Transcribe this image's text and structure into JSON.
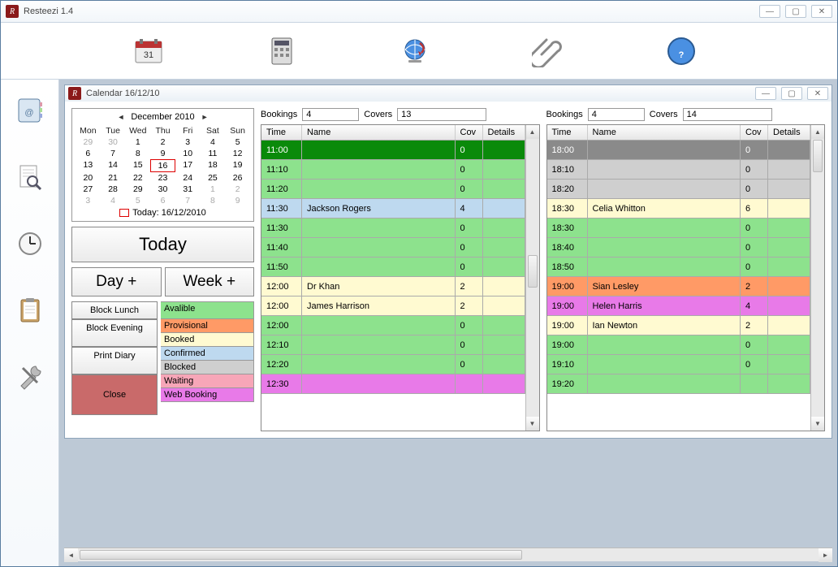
{
  "app": {
    "title": "Resteezi 1.4"
  },
  "calWin": {
    "title": "Calendar 16/12/10"
  },
  "month": {
    "label": "December 2010",
    "dow": [
      "Mon",
      "Tue",
      "Wed",
      "Thu",
      "Fri",
      "Sat",
      "Sun"
    ],
    "cells": [
      {
        "n": "29",
        "o": true
      },
      {
        "n": "30",
        "o": true
      },
      {
        "n": "1"
      },
      {
        "n": "2"
      },
      {
        "n": "3"
      },
      {
        "n": "4"
      },
      {
        "n": "5"
      },
      {
        "n": "6"
      },
      {
        "n": "7"
      },
      {
        "n": "8"
      },
      {
        "n": "9"
      },
      {
        "n": "10"
      },
      {
        "n": "11"
      },
      {
        "n": "12"
      },
      {
        "n": "13"
      },
      {
        "n": "14"
      },
      {
        "n": "15"
      },
      {
        "n": "16",
        "today": true
      },
      {
        "n": "17"
      },
      {
        "n": "18"
      },
      {
        "n": "19"
      },
      {
        "n": "20"
      },
      {
        "n": "21"
      },
      {
        "n": "22"
      },
      {
        "n": "23"
      },
      {
        "n": "24"
      },
      {
        "n": "25"
      },
      {
        "n": "26"
      },
      {
        "n": "27"
      },
      {
        "n": "28"
      },
      {
        "n": "29"
      },
      {
        "n": "30"
      },
      {
        "n": "31"
      },
      {
        "n": "1",
        "o": true
      },
      {
        "n": "2",
        "o": true
      },
      {
        "n": "3",
        "o": true
      },
      {
        "n": "4",
        "o": true
      },
      {
        "n": "5",
        "o": true
      },
      {
        "n": "6",
        "o": true
      },
      {
        "n": "7",
        "o": true
      },
      {
        "n": "8",
        "o": true
      },
      {
        "n": "9",
        "o": true
      }
    ],
    "todayLine": "Today: 16/12/2010"
  },
  "buttons": {
    "today": "Today",
    "dayPlus": "Day +",
    "weekPlus": "Week +",
    "blockLunch": "Block Lunch",
    "blockEvening": "Block Evening",
    "printDiary": "Print Diary",
    "close": "Close"
  },
  "legend": {
    "available": "Avalible",
    "provisional": "Provisional",
    "booked": "Booked",
    "confirmed": "Confirmed",
    "blocked": "Blocked",
    "waiting": "Waiting",
    "web": "Web Booking"
  },
  "colors": {
    "available": "#8de28d",
    "availableDark": "#0a8a0a",
    "provisional": "#ff9a66",
    "booked": "#fffad1",
    "confirmed": "#bed9ef",
    "blocked": "#cfcfcf",
    "blockedDark": "#8a8a8a",
    "waiting": "#f7a6b8",
    "web": "#e87ae8"
  },
  "left": {
    "bookingsLabel": "Bookings",
    "bookings": "4",
    "coversLabel": "Covers",
    "covers": "13",
    "headers": {
      "time": "Time",
      "name": "Name",
      "cov": "Cov",
      "details": "Details"
    },
    "rows": [
      {
        "t": "11:00",
        "n": "",
        "c": "0",
        "bg": "availableDark",
        "fg": "#fff"
      },
      {
        "t": "11:10",
        "n": "",
        "c": "0",
        "bg": "available"
      },
      {
        "t": "11:20",
        "n": "",
        "c": "0",
        "bg": "available"
      },
      {
        "t": "11:30",
        "n": "Jackson Rogers",
        "c": "4",
        "bg": "confirmed"
      },
      {
        "t": "11:30",
        "n": "",
        "c": "0",
        "bg": "available"
      },
      {
        "t": "11:40",
        "n": "",
        "c": "0",
        "bg": "available"
      },
      {
        "t": "11:50",
        "n": "",
        "c": "0",
        "bg": "available"
      },
      {
        "t": "12:00",
        "n": "Dr Khan",
        "c": "2",
        "bg": "booked"
      },
      {
        "t": "12:00",
        "n": "James Harrison",
        "c": "2",
        "bg": "booked"
      },
      {
        "t": "12:00",
        "n": "",
        "c": "0",
        "bg": "available"
      },
      {
        "t": "12:10",
        "n": "",
        "c": "0",
        "bg": "available"
      },
      {
        "t": "12:20",
        "n": "",
        "c": "0",
        "bg": "available"
      },
      {
        "t": "12:30",
        "n": "",
        "c": "",
        "bg": "web"
      }
    ]
  },
  "right": {
    "bookingsLabel": "Bookings",
    "bookings": "4",
    "coversLabel": "Covers",
    "covers": "14",
    "headers": {
      "time": "Time",
      "name": "Name",
      "cov": "Cov",
      "details": "Details"
    },
    "rows": [
      {
        "t": "18:00",
        "n": "",
        "c": "0",
        "bg": "blockedDark",
        "fg": "#fff"
      },
      {
        "t": "18:10",
        "n": "",
        "c": "0",
        "bg": "blocked"
      },
      {
        "t": "18:20",
        "n": "",
        "c": "0",
        "bg": "blocked"
      },
      {
        "t": "18:30",
        "n": "Celia Whitton",
        "c": "6",
        "bg": "booked"
      },
      {
        "t": "18:30",
        "n": "",
        "c": "0",
        "bg": "available"
      },
      {
        "t": "18:40",
        "n": "",
        "c": "0",
        "bg": "available"
      },
      {
        "t": "18:50",
        "n": "",
        "c": "0",
        "bg": "available"
      },
      {
        "t": "19:00",
        "n": "Sian Lesley",
        "c": "2",
        "bg": "provisional"
      },
      {
        "t": "19:00",
        "n": "Helen Harris",
        "c": "4",
        "bg": "web"
      },
      {
        "t": "19:00",
        "n": "Ian Newton",
        "c": "2",
        "bg": "booked"
      },
      {
        "t": "19:00",
        "n": "",
        "c": "0",
        "bg": "available"
      },
      {
        "t": "19:10",
        "n": "",
        "c": "0",
        "bg": "available"
      },
      {
        "t": "19:20",
        "n": "",
        "c": "",
        "bg": "available"
      }
    ]
  }
}
